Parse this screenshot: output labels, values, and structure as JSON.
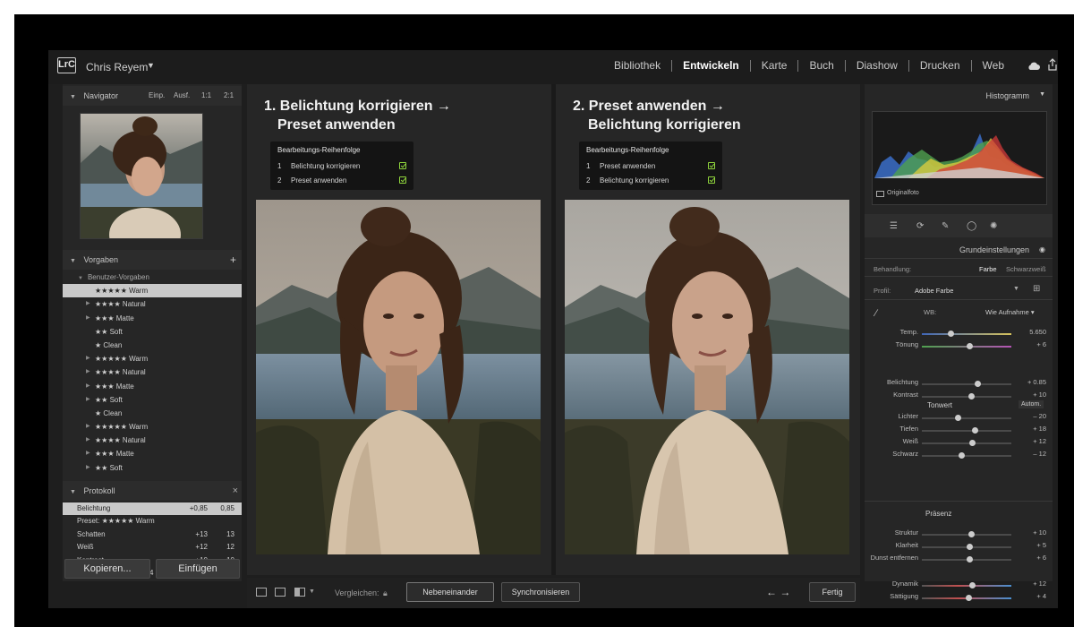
{
  "app": {
    "logo": "LrC",
    "user": "Chris Reyem",
    "modules": [
      "Bibliothek",
      "Entwickeln",
      "Karte",
      "Buch",
      "Diashow",
      "Drucken",
      "Web"
    ],
    "active_module": "Entwickeln"
  },
  "navigator": {
    "title": "Navigator",
    "zoom": [
      "Einp.",
      "Ausf.",
      "1:1",
      "2:1"
    ]
  },
  "presets": {
    "title": "Vorgaben",
    "add": "+",
    "group": "Benutzer-Vorgaben",
    "items": [
      {
        "label": "★★★★★ Warm",
        "selected": true,
        "expander": false
      },
      {
        "label": "★★★★ Natural",
        "selected": false,
        "expander": true
      },
      {
        "label": "★★★ Matte",
        "selected": false,
        "expander": true
      },
      {
        "label": "★★ Soft",
        "selected": false,
        "expander": false
      },
      {
        "label": "★ Clean",
        "selected": false,
        "expander": false
      },
      {
        "label": "★★★★★ Warm",
        "selected": false,
        "expander": true
      },
      {
        "label": "★★★★ Natural",
        "selected": false,
        "expander": true
      },
      {
        "label": "★★★ Matte",
        "selected": false,
        "expander": true
      },
      {
        "label": "★★ Soft",
        "selected": false,
        "expander": true
      },
      {
        "label": "★ Clean",
        "selected": false,
        "expander": false
      },
      {
        "label": "★★★★★ Warm",
        "selected": false,
        "expander": true
      },
      {
        "label": "★★★★ Natural",
        "selected": false,
        "expander": true
      },
      {
        "label": "★★★ Matte",
        "selected": false,
        "expander": true
      },
      {
        "label": "★★ Soft",
        "selected": false,
        "expander": true
      }
    ]
  },
  "history": {
    "title": "Protokoll",
    "close": "×",
    "items": [
      {
        "name": "Belichtung",
        "a": "+0,85",
        "b": "0,85",
        "selected": true
      },
      {
        "name": "Preset: ★★★★★ Warm",
        "a": "",
        "b": "",
        "selected": false
      },
      {
        "name": "Schatten",
        "a": "+13",
        "b": "13",
        "selected": false
      },
      {
        "name": "Weiß",
        "a": "+12",
        "b": "12",
        "selected": false
      },
      {
        "name": "Kontrast",
        "a": "+10",
        "b": "10",
        "selected": false
      },
      {
        "name": "Importieren (23.05.2024 10:15:42)",
        "a": "",
        "b": "",
        "selected": false
      }
    ],
    "copy_button": "Kopieren...",
    "paste_button": "Einfügen"
  },
  "compare": {
    "left": {
      "title_line1": "1. Belichtung korrigieren →",
      "title_line2": "Preset anwenden",
      "order_title": "Bearbeitungs-Reihenfolge",
      "steps": [
        {
          "num": "1",
          "text": "Belichtung korrigieren"
        },
        {
          "num": "2",
          "text": "Preset anwenden"
        }
      ]
    },
    "right": {
      "title_line1": "2. Preset anwenden →",
      "title_line2": "Belichtung korrigieren",
      "order_title": "Bearbeitungs-Reihenfolge",
      "steps": [
        {
          "num": "1",
          "text": "Preset anwenden"
        },
        {
          "num": "2",
          "text": "Belichtung korrigieren"
        }
      ]
    }
  },
  "toolbar": {
    "compare_label": "Vergleichen:",
    "side_by_side": "Nebeneinander",
    "sync": "Synchronisieren",
    "arrows": "← →",
    "done": "Fertig"
  },
  "right_panel": {
    "histogram_title": "Histogramm",
    "original_photo": "Originalfoto",
    "basic_title": "Grundeinstellungen",
    "treatment_label": "Behandlung:",
    "treatment_color": "Farbe",
    "treatment_bw": "Schwarzweiß",
    "profile_label": "Profil:",
    "profile_value": "Adobe Farbe",
    "wb_label": "WB:",
    "wb_value": "Wie Aufnahme ▾",
    "tone_title": "Tonwert",
    "auto": "Autom.",
    "presence_title": "Präsenz",
    "sliders": [
      {
        "label": "Temp.",
        "value": "5.650",
        "pos": 0.32
      },
      {
        "label": "Tönung",
        "value": "+ 6",
        "pos": 0.53
      },
      {
        "label": "Belichtung",
        "value": "+ 0.85",
        "pos": 0.62
      },
      {
        "label": "Kontrast",
        "value": "+ 10",
        "pos": 0.55
      },
      {
        "label": "Lichter",
        "value": "– 20",
        "pos": 0.4
      },
      {
        "label": "Tiefen",
        "value": "+ 18",
        "pos": 0.59
      },
      {
        "label": "Weiß",
        "value": "+ 12",
        "pos": 0.56
      },
      {
        "label": "Schwarz",
        "value": "– 12",
        "pos": 0.44
      },
      {
        "label": "Struktur",
        "value": "+ 10",
        "pos": 0.55
      },
      {
        "label": "Klarheit",
        "value": "+ 5",
        "pos": 0.53
      },
      {
        "label": "Dunst entfernen",
        "value": "+ 6",
        "pos": 0.53
      },
      {
        "label": "Dynamik",
        "value": "+ 12",
        "pos": 0.56
      },
      {
        "label": "Sättigung",
        "value": "+ 4",
        "pos": 0.52
      }
    ]
  },
  "colors": {
    "accent_check": "#8fd43c",
    "panel": "#262626",
    "selected_row": "#c9c9c9"
  }
}
